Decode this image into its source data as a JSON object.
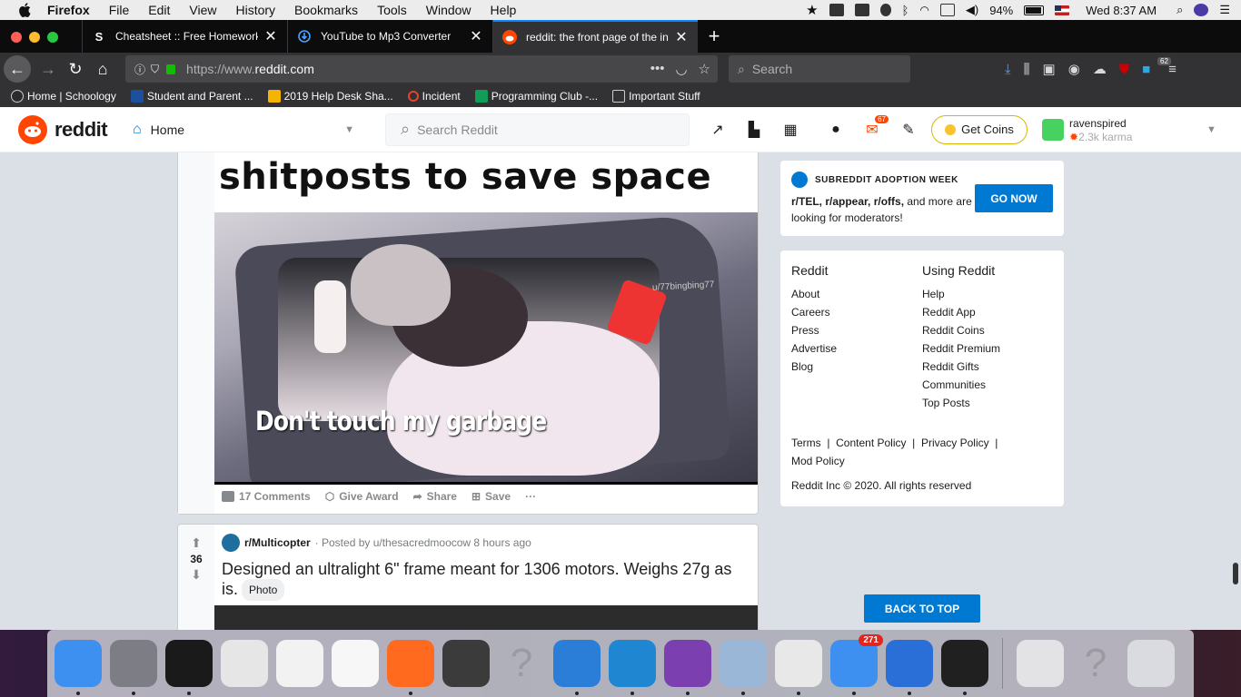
{
  "menubar": {
    "app": "Firefox",
    "items": [
      "File",
      "Edit",
      "View",
      "History",
      "Bookmarks",
      "Tools",
      "Window",
      "Help"
    ],
    "battery": "94%",
    "clock": "Wed 8:37 AM"
  },
  "tabs": [
    {
      "label": "Cheatsheet :: Free Homework H",
      "favicon": "S",
      "active": false
    },
    {
      "label": "YouTube to Mp3 Converter",
      "favicon": "download-icon",
      "active": false
    },
    {
      "label": "reddit: the front page of the inte",
      "favicon": "reddit-icon",
      "active": true
    }
  ],
  "nav": {
    "url_prefix": "https://www.",
    "url_domain": "reddit.com",
    "search_placeholder": "Search",
    "extension_badge": "62"
  },
  "bookmarks": [
    {
      "label": "Home | Schoology",
      "color": "#2b2b2b"
    },
    {
      "label": "Student and Parent ...",
      "color": "#1c4f9c"
    },
    {
      "label": "2019 Help Desk Sha...",
      "color": "#f4b400"
    },
    {
      "label": "Incident",
      "color": "#e8412c"
    },
    {
      "label": "Programming Club -...",
      "color": "#0f9d58"
    },
    {
      "label": "Important Stuff",
      "color": "#888888"
    }
  ],
  "reddit_header": {
    "logo": "reddit",
    "feed": "Home",
    "search_placeholder": "Search Reddit",
    "notifications": "67",
    "get_coins": "Get Coins",
    "username": "ravenspired",
    "karma": "2.3k karma"
  },
  "post1": {
    "title_text": "shitposts to save space",
    "caption": "Don't touch my garbage",
    "watermark": "u/77bingbing77",
    "actions": {
      "comments": "17 Comments",
      "award": "Give Award",
      "share": "Share",
      "save": "Save",
      "more": "···"
    }
  },
  "post2": {
    "votes": "36",
    "subreddit": "r/Multicopter",
    "posted_by": "· Posted by u/thesacredmoocow 8 hours ago",
    "title": "Designed an ultralight 6\" frame meant for 1306 motors. Weighs 27g as is.",
    "flair": "Photo"
  },
  "sidebar": {
    "adopt_header": "SUBREDDIT ADOPTION WEEK",
    "adopt_subs": "r/TEL, r/appear, r/offs,",
    "adopt_rest": " and more are looking for moderators!",
    "go_now": "GO NOW",
    "col1_title": "Reddit",
    "col1": [
      "About",
      "Careers",
      "Press",
      "Advertise",
      "Blog"
    ],
    "col2_title": "Using Reddit",
    "col2": [
      "Help",
      "Reddit App",
      "Reddit Coins",
      "Reddit Premium",
      "Reddit Gifts",
      "Communities",
      "Top Posts"
    ],
    "legal": "Terms  |  Content Policy  |  Privacy Policy  |  Mod Policy",
    "copyright": "Reddit Inc © 2020. All rights reserved",
    "back_to_top": "BACK TO TOP"
  },
  "dock": {
    "apps": [
      {
        "name": "finder-icon",
        "color": "#3d8ff0"
      },
      {
        "name": "system-preferences-icon",
        "color": "#7d7d85"
      },
      {
        "name": "terminal-icon",
        "color": "#1a1a1a"
      },
      {
        "name": "script-editor-icon",
        "color": "#e6e6e6"
      },
      {
        "name": "textedit-icon",
        "color": "#f2f2f2"
      },
      {
        "name": "notes-icon",
        "color": "#f7f7f7"
      },
      {
        "name": "firefox-icon",
        "color": "#ff6a1f"
      },
      {
        "name": "sublime-text-icon",
        "color": "#3b3b3b"
      },
      {
        "name": "unknown-app-icon",
        "color": "#c9c9d0"
      },
      {
        "name": "vnc-viewer-icon",
        "color": "#2a7ed8"
      },
      {
        "name": "vscode-icon",
        "color": "#1f86d1"
      },
      {
        "name": "github-desktop-icon",
        "color": "#7b3fb0"
      },
      {
        "name": "preview-icon",
        "color": "#9bb7d8"
      },
      {
        "name": "chrome-icon",
        "color": "#e8e8e8"
      },
      {
        "name": "mail-icon",
        "color": "#3d8ff0"
      },
      {
        "name": "bluetooth-file-exchange-icon",
        "color": "#2a6fd8"
      },
      {
        "name": "activity-monitor-icon",
        "color": "#202020"
      }
    ],
    "mail_badge": "271",
    "right_items": [
      {
        "name": "music-folder-icon",
        "color": "#e3e3e6"
      },
      {
        "name": "unknown-folder-icon",
        "color": "#c9c9d0"
      },
      {
        "name": "trash-icon",
        "color": "#d9dbe0"
      }
    ]
  }
}
